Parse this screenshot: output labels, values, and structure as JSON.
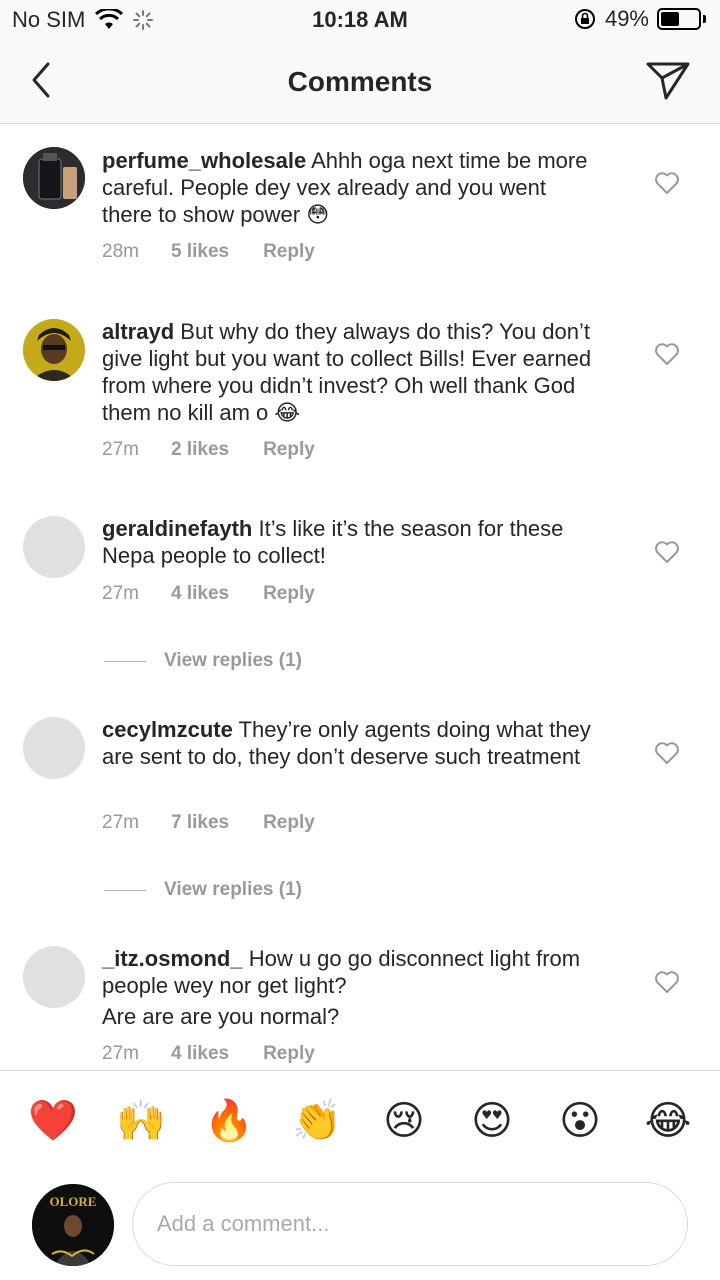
{
  "status": {
    "carrier": "No SIM",
    "time": "10:18 AM",
    "battery": "49%",
    "battery_level": 0.49
  },
  "header": {
    "title": "Comments",
    "back_icon": "chevron-left-icon",
    "send_icon": "paper-plane-icon"
  },
  "comments": [
    {
      "username": "perfume_wholesale",
      "text": "Ahhh oga next time be more careful. People dey vex already and you went there to show power 😳",
      "time": "28m",
      "likes": "5 likes",
      "reply": "Reply"
    },
    {
      "username": "altrayd",
      "text": "But why do they always do this? You don’t give light but you want to collect Bills! Ever earned from where you didn’t invest? Oh well thank God them no kill am o 😂",
      "time": "27m",
      "likes": "2 likes",
      "reply": "Reply"
    },
    {
      "username": "geraldinefayth",
      "text": "It’s like it’s the season for these Nepa people to collect!",
      "time": "27m",
      "likes": "4 likes",
      "reply": "Reply",
      "view_replies": "View replies (1)"
    },
    {
      "username": "cecylmzcute",
      "text": "They’re only agents doing what they are sent to do, they don’t deserve such treatment",
      "time": "27m",
      "likes": "7 likes",
      "reply": "Reply",
      "view_replies": "View replies (1)"
    },
    {
      "username": "_itz.osmond_",
      "text": "How u go go disconnect light from people wey nor get light?",
      "text2": "Are are are you normal?",
      "time": "27m",
      "likes": "4 likes",
      "reply": "Reply"
    }
  ],
  "reactions": [
    "❤️",
    "🙌",
    "🔥",
    "👏",
    "😢",
    "😍",
    "😮",
    "😂"
  ],
  "composer": {
    "placeholder": "Add a comment...",
    "avatar_text": "OLORE"
  },
  "colors": {
    "text": "#262626",
    "muted": "#999999",
    "divider": "#dbdbdb"
  }
}
